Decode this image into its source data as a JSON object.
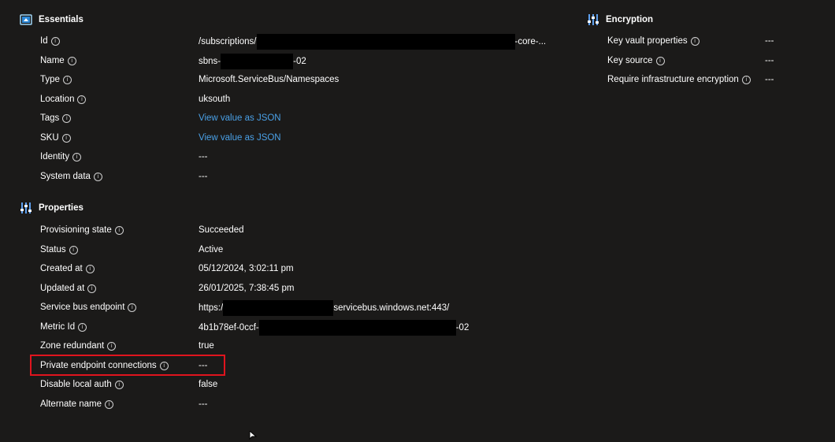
{
  "essentials": {
    "title": "Essentials",
    "rows": [
      {
        "label": "Id",
        "value_prefix": "/subscriptions/",
        "value_suffix": "-core-...",
        "redacted": true
      },
      {
        "label": "Name",
        "value_prefix": "sbns-",
        "value_suffix": "-02",
        "redacted": true
      },
      {
        "label": "Type",
        "value": "Microsoft.ServiceBus/Namespaces"
      },
      {
        "label": "Location",
        "value": "uksouth"
      },
      {
        "label": "Tags",
        "link": "View value as JSON"
      },
      {
        "label": "SKU",
        "link": "View value as JSON"
      },
      {
        "label": "Identity",
        "value": "---"
      },
      {
        "label": "System data",
        "value": "---"
      }
    ]
  },
  "encryption": {
    "title": "Encryption",
    "rows": [
      {
        "label": "Key vault properties",
        "value": "---"
      },
      {
        "label": "Key source",
        "value": "---"
      },
      {
        "label": "Require infrastructure encryption",
        "value": "---"
      }
    ]
  },
  "properties": {
    "title": "Properties",
    "rows": [
      {
        "label": "Provisioning state",
        "value": "Succeeded"
      },
      {
        "label": "Status",
        "value": "Active"
      },
      {
        "label": "Created at",
        "value": "05/12/2024, 3:02:11 pm"
      },
      {
        "label": "Updated at",
        "value": "26/01/2025, 7:38:45 pm"
      },
      {
        "label": "Service bus endpoint",
        "value_prefix": "https:/",
        "value_suffix": "servicebus.windows.net:443/",
        "redacted": true
      },
      {
        "label": "Metric Id",
        "value_prefix": "4b1b78ef-0ccf-",
        "value_suffix": "-02",
        "redacted": true
      },
      {
        "label": "Zone redundant",
        "value": "true"
      },
      {
        "label": "Private endpoint connections",
        "value": "---",
        "highlighted": true
      },
      {
        "label": "Disable local auth",
        "value": "false"
      },
      {
        "label": "Alternate name",
        "value": "---"
      }
    ]
  },
  "info_glyph": "i",
  "colors": {
    "background": "#1b1a19",
    "link": "#4aa0e6",
    "highlight": "#e0141e"
  }
}
